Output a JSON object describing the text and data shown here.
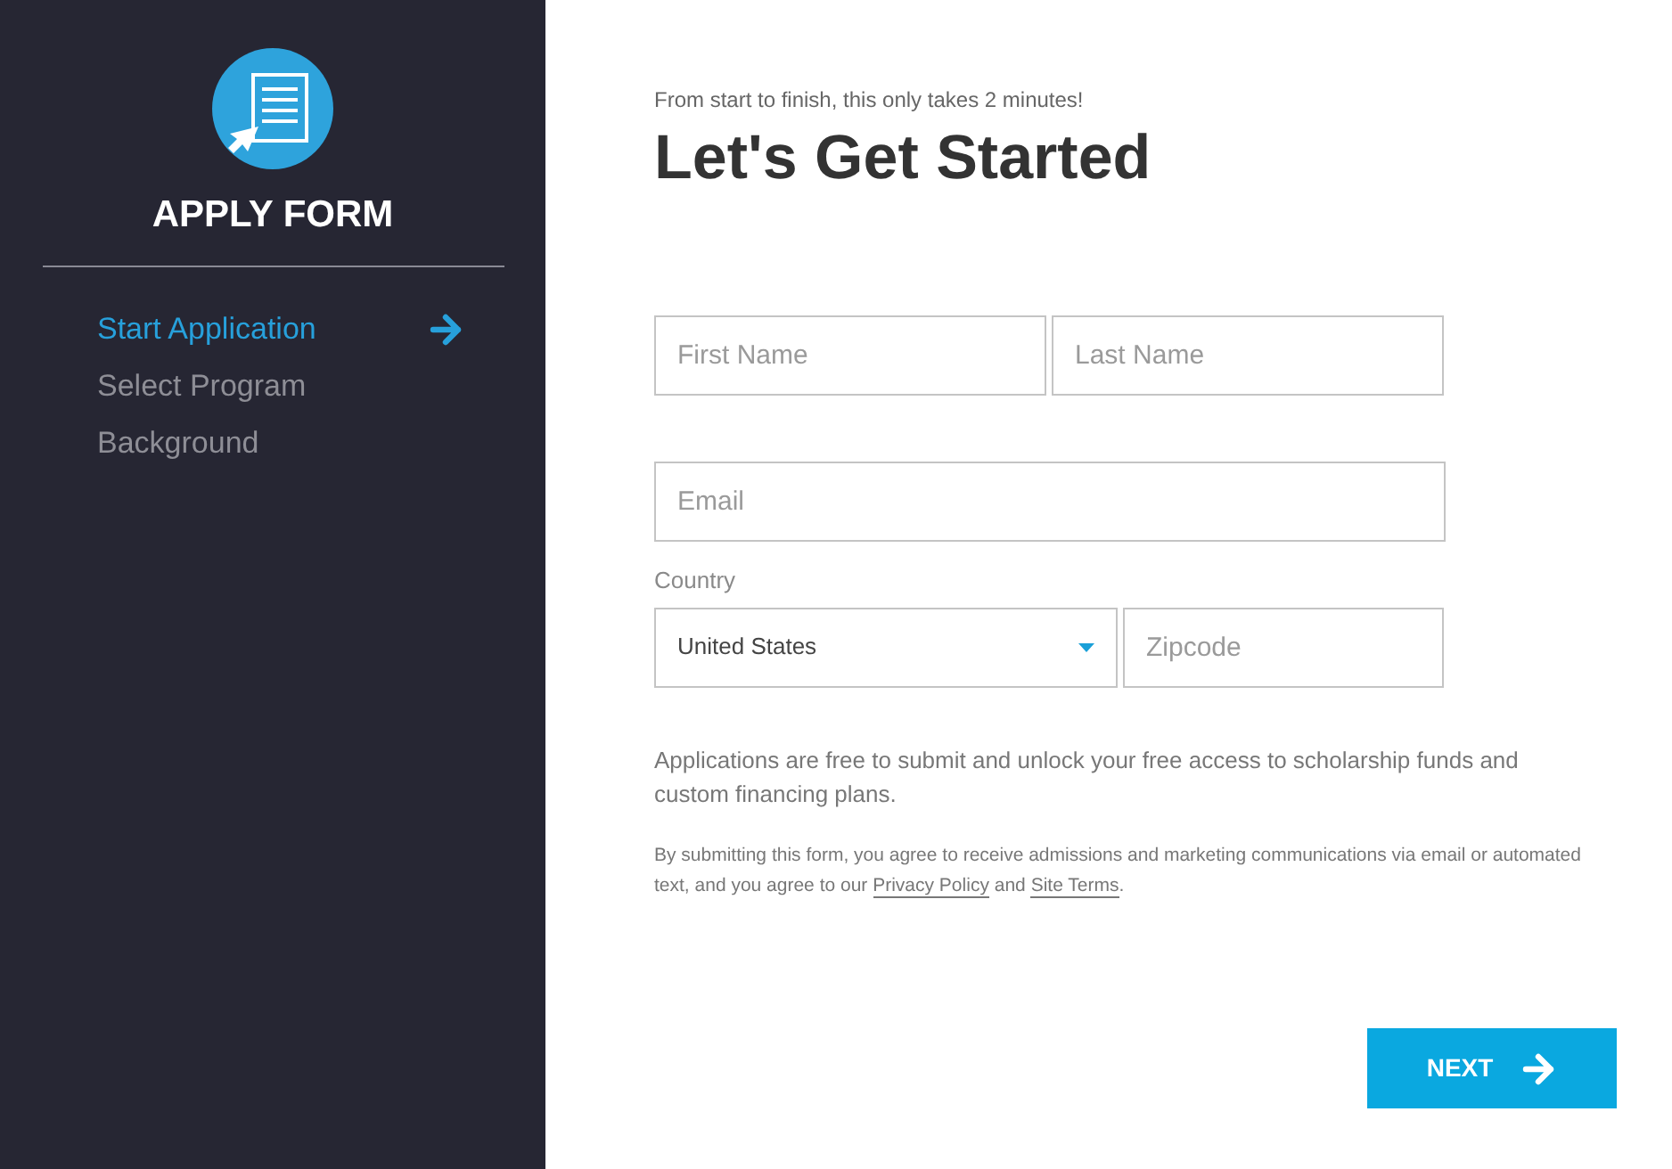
{
  "sidebar": {
    "title": "APPLY FORM",
    "steps": [
      {
        "label": "Start Application",
        "selected": true
      },
      {
        "label": "Select Program",
        "selected": false
      },
      {
        "label": "Background",
        "selected": false
      }
    ]
  },
  "form": {
    "tagline": "From start to finish, this only takes 2 minutes!",
    "heading": "Let's Get Started",
    "first_name": {
      "placeholder": "First Name"
    },
    "last_name": {
      "placeholder": "Last Name"
    },
    "email": {
      "placeholder": "Email"
    },
    "country": {
      "label": "Country",
      "value": "United States"
    },
    "zipcode": {
      "placeholder": "Zipcode"
    },
    "note": "Applications are free to submit and unlock your free access to scholarship funds and custom financing plans.",
    "legal": [
      {
        "kind": "text",
        "text": "By submitting this form, you agree to receive admissions and marketing communications via email or automated text, and you agree to our "
      },
      {
        "kind": "link",
        "text": "Privacy Policy"
      },
      {
        "kind": "text",
        "text": " and "
      },
      {
        "kind": "link",
        "text": "Site Terms"
      },
      {
        "kind": "text",
        "text": "."
      }
    ],
    "next_button": "NEXT"
  }
}
